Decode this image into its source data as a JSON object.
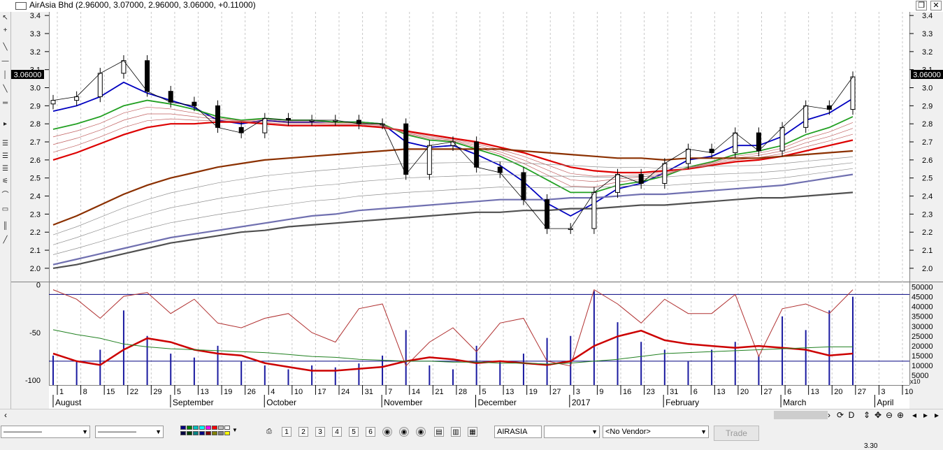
{
  "window": {
    "title": "AirAsia Bhd (2.96000, 3.07000, 2.96000, 3.06000, +0.11000)",
    "restore_glyph": "❐",
    "close_glyph": "✕"
  },
  "price_panel": {
    "y_ticks": [
      "3.4",
      "3.3",
      "3.2",
      "3.1",
      "3.0",
      "2.9",
      "2.8",
      "2.7",
      "2.6",
      "2.5",
      "2.4",
      "2.3",
      "2.2",
      "2.1",
      "2.0"
    ],
    "last_price_label": "3.06000"
  },
  "indicator_panel": {
    "left_ticks": [
      "0",
      "-50",
      "-100"
    ],
    "right_ticks": [
      "50000",
      "45000",
      "40000",
      "35000",
      "30000",
      "25000",
      "20000",
      "15000",
      "10000",
      "5000"
    ],
    "multiplier_label": "x10"
  },
  "date_axis": {
    "day_ticks": [
      "1",
      "8",
      "15",
      "22",
      "29",
      "5",
      "13",
      "19",
      "26",
      "4",
      "10",
      "17",
      "24",
      "31",
      "7",
      "14",
      "21",
      "28",
      "5",
      "13",
      "19",
      "27",
      "3",
      "9",
      "16",
      "23",
      "31",
      "6",
      "13",
      "20",
      "27",
      "6",
      "13",
      "20",
      "27",
      "3",
      "10"
    ],
    "month_labels": [
      "August",
      "September",
      "October",
      "November",
      "December",
      "2017",
      "February",
      "March",
      "April"
    ]
  },
  "chart_data": {
    "type": "line",
    "title": "AirAsia Bhd (2.96000, 3.07000, 2.96000, 3.06000, +0.11000)",
    "xlabel": "",
    "ylabel": "",
    "ylim": [
      1.93,
      3.42
    ],
    "x": [
      "Aug 1",
      "Aug 8",
      "Aug 15",
      "Aug 22",
      "Aug 29",
      "Sep 5",
      "Sep 13",
      "Sep 19",
      "Sep 26",
      "Oct 4",
      "Oct 10",
      "Oct 17",
      "Oct 24",
      "Oct 31",
      "Nov 7",
      "Nov 14",
      "Nov 21",
      "Nov 28",
      "Dec 5",
      "Dec 13",
      "Dec 19",
      "Dec 27",
      "Jan 3",
      "Jan 9",
      "Jan 16",
      "Jan 23",
      "Jan 31",
      "Feb 6",
      "Feb 13",
      "Feb 20",
      "Feb 27",
      "Mar 6",
      "Mar 13",
      "Mar 20",
      "Mar 27"
    ],
    "series": [
      {
        "values": [
          2.93,
          2.95,
          3.08,
          3.15,
          2.98,
          2.92,
          2.9,
          2.78,
          2.75,
          2.83,
          2.82,
          2.82,
          2.82,
          2.8,
          2.8,
          2.52,
          2.68,
          2.7,
          2.56,
          2.53,
          2.38,
          2.22,
          2.22,
          2.42,
          2.52,
          2.47,
          2.58,
          2.66,
          2.64,
          2.75,
          2.65,
          2.78,
          2.9,
          2.88,
          3.06
        ],
        "color": "#000000"
      },
      {
        "values": [
          2.87,
          2.9,
          2.95,
          3.03,
          2.97,
          2.93,
          2.89,
          2.82,
          2.8,
          2.82,
          2.81,
          2.81,
          2.81,
          2.81,
          2.8,
          2.7,
          2.67,
          2.68,
          2.63,
          2.57,
          2.48,
          2.36,
          2.29,
          2.36,
          2.44,
          2.47,
          2.53,
          2.6,
          2.62,
          2.68,
          2.68,
          2.73,
          2.82,
          2.86,
          2.94
        ],
        "color": "#0000c0"
      },
      {
        "values": [
          2.77,
          2.8,
          2.84,
          2.9,
          2.93,
          2.91,
          2.88,
          2.84,
          2.82,
          2.83,
          2.82,
          2.82,
          2.81,
          2.81,
          2.8,
          2.74,
          2.71,
          2.7,
          2.66,
          2.62,
          2.56,
          2.49,
          2.42,
          2.42,
          2.46,
          2.48,
          2.51,
          2.56,
          2.59,
          2.63,
          2.65,
          2.68,
          2.74,
          2.78,
          2.84
        ],
        "color": "#22a022"
      },
      {
        "values": [
          2.6,
          2.64,
          2.69,
          2.74,
          2.78,
          2.8,
          2.8,
          2.81,
          2.81,
          2.8,
          2.79,
          2.79,
          2.79,
          2.79,
          2.78,
          2.76,
          2.74,
          2.72,
          2.7,
          2.67,
          2.64,
          2.6,
          2.56,
          2.54,
          2.53,
          2.53,
          2.54,
          2.55,
          2.57,
          2.59,
          2.6,
          2.62,
          2.65,
          2.68,
          2.71
        ],
        "color": "#dd0000"
      },
      {
        "values": [
          2.24,
          2.29,
          2.35,
          2.41,
          2.46,
          2.5,
          2.53,
          2.56,
          2.58,
          2.6,
          2.61,
          2.62,
          2.63,
          2.64,
          2.65,
          2.66,
          2.66,
          2.66,
          2.66,
          2.66,
          2.65,
          2.64,
          2.63,
          2.62,
          2.61,
          2.61,
          2.6,
          2.61,
          2.61,
          2.61,
          2.61,
          2.62,
          2.63,
          2.64,
          2.65
        ],
        "color": "#8b3000"
      },
      {
        "values": [
          2.02,
          2.05,
          2.08,
          2.11,
          2.14,
          2.17,
          2.19,
          2.21,
          2.23,
          2.25,
          2.27,
          2.29,
          2.3,
          2.32,
          2.33,
          2.34,
          2.35,
          2.36,
          2.37,
          2.38,
          2.38,
          2.38,
          2.39,
          2.39,
          2.4,
          2.41,
          2.41,
          2.42,
          2.43,
          2.44,
          2.45,
          2.46,
          2.48,
          2.5,
          2.52
        ],
        "color": "#7070b0"
      },
      {
        "values": [
          2.0,
          2.02,
          2.05,
          2.08,
          2.11,
          2.14,
          2.16,
          2.18,
          2.2,
          2.21,
          2.23,
          2.24,
          2.25,
          2.26,
          2.27,
          2.28,
          2.29,
          2.3,
          2.31,
          2.31,
          2.32,
          2.32,
          2.33,
          2.33,
          2.34,
          2.35,
          2.35,
          2.36,
          2.37,
          2.38,
          2.39,
          2.39,
          2.4,
          2.41,
          2.42
        ],
        "color": "#505050"
      }
    ],
    "indicator": {
      "ylim": [
        -105,
        2
      ],
      "reference_lines": [
        -10,
        -80
      ],
      "series": [
        {
          "values": [
            -5,
            -15,
            -35,
            -12,
            -8,
            -30,
            -15,
            -40,
            -45,
            -35,
            -30,
            -50,
            -60,
            -25,
            -20,
            -85,
            -60,
            -45,
            -70,
            -40,
            -35,
            -80,
            -85,
            -5,
            -20,
            -40,
            -15,
            -30,
            -30,
            -10,
            -75,
            -25,
            -20,
            -30,
            -5
          ],
          "color": "#b03030"
        },
        {
          "values": [
            -72,
            -80,
            -84,
            -68,
            -56,
            -60,
            -68,
            -72,
            -74,
            -82,
            -86,
            -90,
            -90,
            -88,
            -86,
            -80,
            -76,
            -78,
            -82,
            -80,
            -82,
            -84,
            -80,
            -64,
            -54,
            -48,
            -58,
            -62,
            -64,
            -66,
            -64,
            -66,
            -68,
            -74,
            -72
          ],
          "color": "#cc0000"
        },
        {
          "values": [
            -47,
            -52,
            -56,
            -62,
            -65,
            -67,
            -68,
            -69,
            -70,
            -71,
            -73,
            -75,
            -76,
            -78,
            -79,
            -80,
            -80,
            -81,
            -81,
            -82,
            -82,
            -83,
            -82,
            -80,
            -78,
            -75,
            -72,
            -71,
            -70,
            -69,
            -68,
            -67,
            -66,
            -65,
            -65
          ],
          "color": "#208020"
        }
      ],
      "volume_bars": [
        15,
        12,
        18,
        38,
        25,
        16,
        14,
        20,
        12,
        10,
        8,
        10,
        9,
        11,
        15,
        28,
        10,
        8,
        20,
        12,
        16,
        24,
        25,
        48,
        32,
        22,
        18,
        12,
        18,
        22,
        15,
        35,
        28,
        38,
        45
      ]
    }
  },
  "toolbar": {
    "symbol": "AIRASIA",
    "vendor": "<No Vendor>",
    "trade_label": "Trade",
    "line_style": "—————",
    "status_text": "3.30"
  },
  "colors": {
    "chart_background": "#ffffff",
    "window_background": "#f0f0f0",
    "price_line": "#000000",
    "short_ema": "#0000c0",
    "mid_ema": "#22a022",
    "long_ema": "#dd0000"
  }
}
